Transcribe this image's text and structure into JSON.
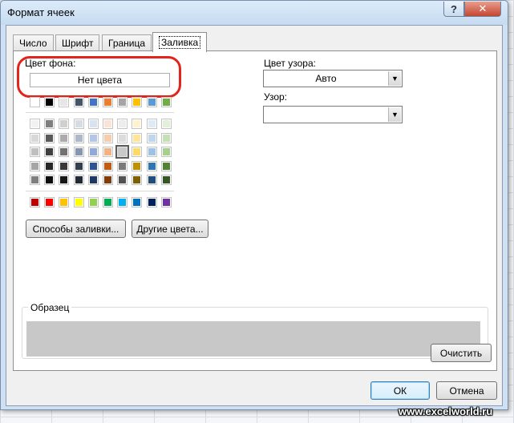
{
  "window": {
    "title": "Формат ячеек",
    "help": "?",
    "close": "✕"
  },
  "tabs": [
    {
      "label": "Число"
    },
    {
      "label": "Шрифт"
    },
    {
      "label": "Граница"
    },
    {
      "label": "Заливка"
    }
  ],
  "background_color": {
    "label": "Цвет фона:",
    "no_color_button": "Нет цвета",
    "highlight_color": "#e2241b"
  },
  "palette": {
    "top_row": [
      "#ffffff",
      "#000000",
      "#e7e6e6",
      "#44546a",
      "#4472c4",
      "#ed7d31",
      "#a5a5a5",
      "#ffc000",
      "#5b9bd5",
      "#70ad47"
    ],
    "shade_rows": [
      [
        "#f2f2f2",
        "#7f7f7f",
        "#d0cece",
        "#d6dce4",
        "#d9e2f3",
        "#fbe4d5",
        "#ededed",
        "#fff2cc",
        "#deeaf6",
        "#e2efd9"
      ],
      [
        "#d8d8d8",
        "#595959",
        "#aeaaaa",
        "#adb9ca",
        "#b4c6e7",
        "#f7cbac",
        "#dbdbdb",
        "#fee599",
        "#bdd7ee",
        "#c5e0b3"
      ],
      [
        "#bfbfbf",
        "#3f3f3f",
        "#757171",
        "#8496b0",
        "#8eaadb",
        "#f4b183",
        "#c9c9c9",
        "#ffd965",
        "#9cc3e5",
        "#a8d08d"
      ],
      [
        "#a5a5a5",
        "#262626",
        "#3a3838",
        "#323f4f",
        "#2e5395",
        "#c55a11",
        "#7b7b7b",
        "#bf9000",
        "#2e75b5",
        "#538135"
      ],
      [
        "#7f7f7f",
        "#0d0d0d",
        "#171616",
        "#222a35",
        "#1f3864",
        "#833c0b",
        "#525252",
        "#7f6000",
        "#1e4e79",
        "#375623"
      ]
    ],
    "selected": {
      "row": 2,
      "col": 6
    },
    "standard_row": [
      "#c00000",
      "#ff0000",
      "#ffc000",
      "#ffff00",
      "#92d050",
      "#00b050",
      "#00b0f0",
      "#0070c0",
      "#002060",
      "#7030a0"
    ]
  },
  "buttons": {
    "fill_effects": "Способы заливки...",
    "more_colors": "Другие цвета...",
    "clear": "Очистить",
    "ok": "ОК",
    "cancel": "Отмена"
  },
  "pattern": {
    "color_label": "Цвет узора:",
    "color_value": "Авто",
    "style_label": "Узор:",
    "style_value": ""
  },
  "sample": {
    "label": "Образец",
    "fill_color": "#c8c8c8"
  },
  "watermark": "www.excelworld.ru"
}
